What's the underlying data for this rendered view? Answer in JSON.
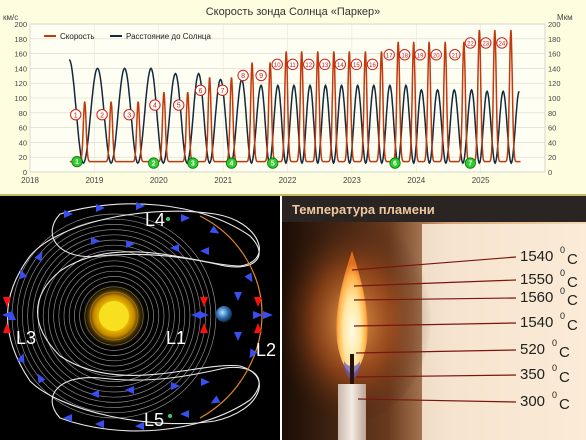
{
  "chart_data": {
    "type": "line",
    "title": "Скорость зонда Солнца «Паркер»",
    "ylabel_left": "км/с",
    "ylabel_right": "Мкм",
    "ylim": [
      0,
      200
    ],
    "yticks": [
      0,
      20,
      40,
      60,
      80,
      100,
      120,
      140,
      160,
      180,
      200
    ],
    "xlim": [
      2018,
      2026
    ],
    "xticks": [
      "2018",
      "2019",
      "2020",
      "2021",
      "2022",
      "2023",
      "2024",
      "2025"
    ],
    "grid": true,
    "legend_position": "top-left",
    "series": [
      {
        "name": "Скорость",
        "color": "#c0390f",
        "perihelion_dates": [
          2018.85,
          2019.26,
          2019.68,
          2020.08,
          2020.45,
          2020.79,
          2021.13,
          2021.45,
          2021.73,
          2021.98,
          2022.22,
          2022.47,
          2022.72,
          2022.96,
          2023.21,
          2023.46,
          2023.72,
          2023.96,
          2024.2,
          2024.45,
          2024.74,
          2024.98,
          2025.22,
          2025.47
        ],
        "perihelion_speeds": [
          95,
          95,
          95,
          108,
          108,
          128,
          128,
          148,
          148,
          163,
          163,
          163,
          163,
          163,
          163,
          163,
          176,
          176,
          176,
          176,
          176,
          192,
          192,
          192
        ],
        "aphelion_speed": 14
      },
      {
        "name": "Расстояние до Солнца",
        "color": "#102a40",
        "aphelion_dates": [
          2018.61,
          2019.05,
          2019.47,
          2019.88,
          2020.26,
          2020.62,
          2020.96,
          2021.29,
          2021.59,
          2021.85,
          2022.1,
          2022.35,
          2022.59,
          2022.84,
          2023.09,
          2023.34,
          2023.59,
          2023.84,
          2024.08,
          2024.33,
          2024.59,
          2024.86,
          2025.1,
          2025.35,
          2025.6
        ],
        "aphelion_distances": [
          152,
          140,
          140,
          140,
          133,
          133,
          125,
          125,
          117,
          117,
          117,
          117,
          117,
          117,
          117,
          117,
          117,
          117,
          111,
          111,
          111,
          111,
          109,
          109,
          109
        ]
      }
    ],
    "annotations": {
      "perihelion_numbers": [
        "1",
        "2",
        "3",
        "4",
        "5",
        "6",
        "7",
        "8",
        "9",
        "10",
        "11",
        "12",
        "13",
        "14",
        "15",
        "16",
        "17",
        "18",
        "19",
        "20",
        "21",
        "22",
        "23",
        "24"
      ],
      "flyby_numbers": [
        "1",
        "2",
        "3",
        "4",
        "5",
        "6",
        "7"
      ],
      "flyby_dates": [
        2018.73,
        2019.92,
        2020.53,
        2021.13,
        2021.77,
        2023.67,
        2024.84
      ]
    }
  },
  "lagrange": {
    "labels": [
      "L1",
      "L2",
      "L3",
      "L4",
      "L5"
    ]
  },
  "flame": {
    "title": "Температура пламени",
    "temps": [
      {
        "value": "1540",
        "sup": "0",
        "unit": "C"
      },
      {
        "value": "1550",
        "sup": "0",
        "unit": "C"
      },
      {
        "value": "1560",
        "sup": "0",
        "unit": "C"
      },
      {
        "value": "1540",
        "sup": "0",
        "unit": "C"
      },
      {
        "value": "520",
        "sup": "0",
        "unit": "C"
      },
      {
        "value": "350",
        "sup": "0",
        "unit": "C"
      },
      {
        "value": "300",
        "sup": "0",
        "unit": "C"
      }
    ]
  }
}
